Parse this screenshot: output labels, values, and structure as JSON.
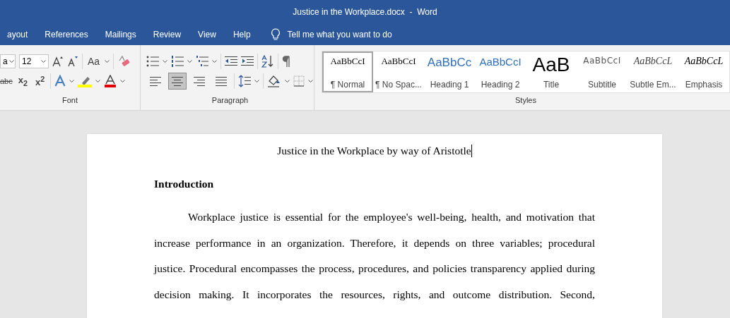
{
  "window": {
    "title": "Justice in the Workplace.docx  -  Word"
  },
  "tabs": [
    {
      "label": "ayout",
      "selected": false
    },
    {
      "label": "References",
      "selected": false
    },
    {
      "label": "Mailings",
      "selected": false
    },
    {
      "label": "Review",
      "selected": false
    },
    {
      "label": "View",
      "selected": false
    },
    {
      "label": "Help",
      "selected": false
    }
  ],
  "tell_me": {
    "placeholder": "Tell me what you want to do"
  },
  "font_group": {
    "label": "Font",
    "font_name": "a",
    "font_size": "12",
    "change_case": "Aa",
    "strikethrough": "abc",
    "subscript": "x$_{2}$",
    "superscript": "x$^{2}$"
  },
  "paragraph_group": {
    "label": "Paragraph",
    "alignments": [
      {
        "kind": "left",
        "selected": false
      },
      {
        "kind": "center",
        "selected": true
      },
      {
        "kind": "right",
        "selected": false
      },
      {
        "kind": "justify",
        "selected": false
      }
    ]
  },
  "styles_group": {
    "label": "Styles",
    "styles": [
      {
        "sample": "AaBbCcI",
        "name": "¶ Normal",
        "kind": "normal",
        "selected": true
      },
      {
        "sample": "AaBbCcI",
        "name": "¶ No Spac...",
        "kind": "nospacing",
        "selected": false
      },
      {
        "sample": "AaBbCc",
        "name": "Heading 1",
        "kind": "heading1",
        "selected": false
      },
      {
        "sample": "AaBbCcI",
        "name": "Heading 2",
        "kind": "heading2",
        "selected": false
      },
      {
        "sample": "AaB",
        "name": "Title",
        "kind": "title",
        "selected": false
      },
      {
        "sample": "AaBbCcI",
        "name": "Subtitle",
        "kind": "subtitle",
        "selected": false
      },
      {
        "sample": "AaBbCcL",
        "name": "Subtle Em...",
        "kind": "subtle",
        "selected": false
      },
      {
        "sample": "AaBbCcL",
        "name": "Emphasis",
        "kind": "emphasis",
        "selected": false
      }
    ]
  },
  "document": {
    "title": "Justice in the Workplace by way of Aristotle",
    "heading": "Introduction",
    "paragraph": "Workplace justice is essential for the employee's well-being, health, and motivation that increase performance in an organization. Therefore, it depends on three variables; procedural justice. Procedural encompasses the process, procedures, and policies transparency applied during decision making. It incorporates the resources, rights, and outcome distribution. Second,"
  }
}
